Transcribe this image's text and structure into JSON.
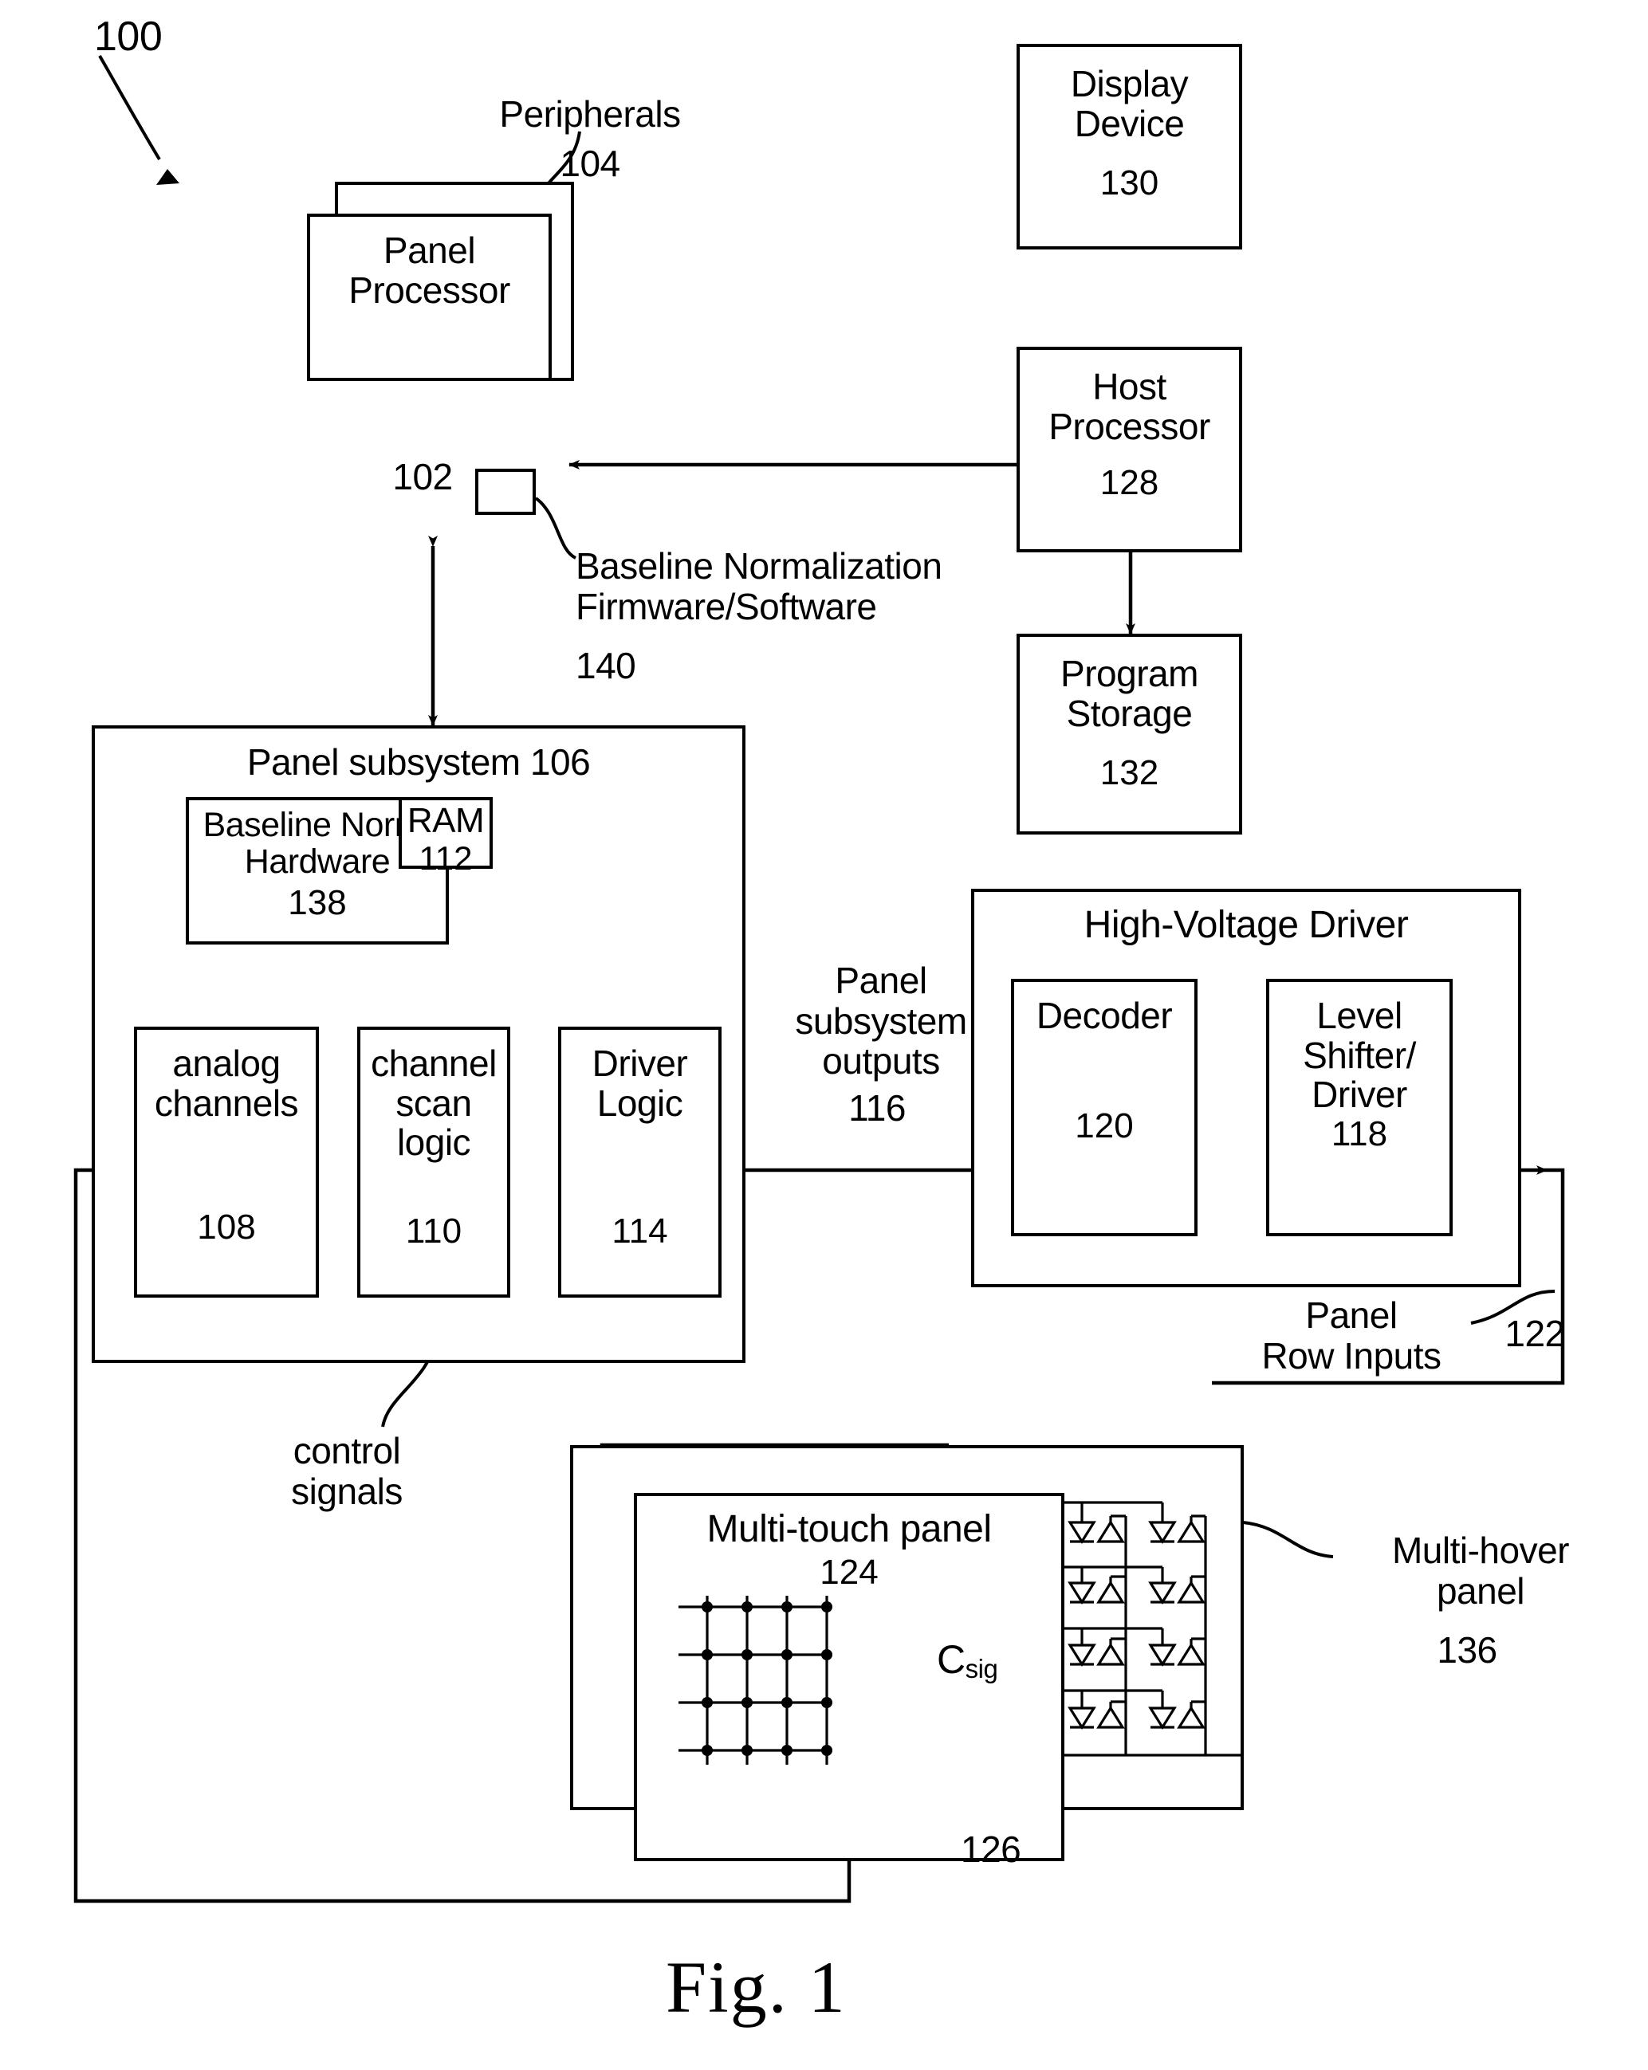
{
  "figure": {
    "caption": "Fig. 1",
    "system_ref": "100"
  },
  "blocks": {
    "peripherals": {
      "label": "Peripherals",
      "ref": "104"
    },
    "panel_processor": {
      "title": "Panel\nProcessor",
      "ref": "102"
    },
    "baseline_norm_fw": {
      "label": "Baseline Normalization\nFirmware/Software",
      "ref": "140"
    },
    "display_device": {
      "title": "Display\nDevice",
      "ref": "130"
    },
    "host_processor": {
      "title": "Host\nProcessor",
      "ref": "128"
    },
    "program_storage": {
      "title": "Program\nStorage",
      "ref": "132"
    },
    "panel_subsystem": {
      "title": "Panel subsystem 106"
    },
    "baseline_norm_hw": {
      "title": "Baseline Norm.\nHardware",
      "ref": "138"
    },
    "ram": {
      "title": "RAM",
      "ref": "112"
    },
    "analog_channels": {
      "title": "analog\nchannels",
      "ref": "108"
    },
    "channel_scan_logic": {
      "title": "channel\nscan\nlogic",
      "ref": "110"
    },
    "driver_logic": {
      "title": "Driver\nLogic",
      "ref": "114"
    },
    "panel_subsystem_outputs": {
      "label": "Panel\nsubsystem\noutputs",
      "ref": "116"
    },
    "high_voltage_driver": {
      "title": "High-Voltage Driver"
    },
    "decoder": {
      "title": "Decoder",
      "ref": "120"
    },
    "level_shifter_driver": {
      "title": "Level\nShifter/\nDriver",
      "ref": "118"
    },
    "panel_row_inputs": {
      "label": "Panel\nRow Inputs",
      "ref": "122"
    },
    "multi_touch_panel": {
      "title": "Multi-touch panel",
      "ref": "124"
    },
    "csig": {
      "label": "C",
      "subscript": "sig"
    },
    "node_ref": {
      "ref": "126"
    },
    "multi_hover_panel": {
      "label": "Multi-hover\npanel",
      "ref": "136"
    },
    "control_signals": {
      "label": "control\nsignals"
    }
  },
  "touch_grid": {
    "rows": 4,
    "cols": 4
  },
  "hover_grid": {
    "rows": 4,
    "cols": 2
  }
}
